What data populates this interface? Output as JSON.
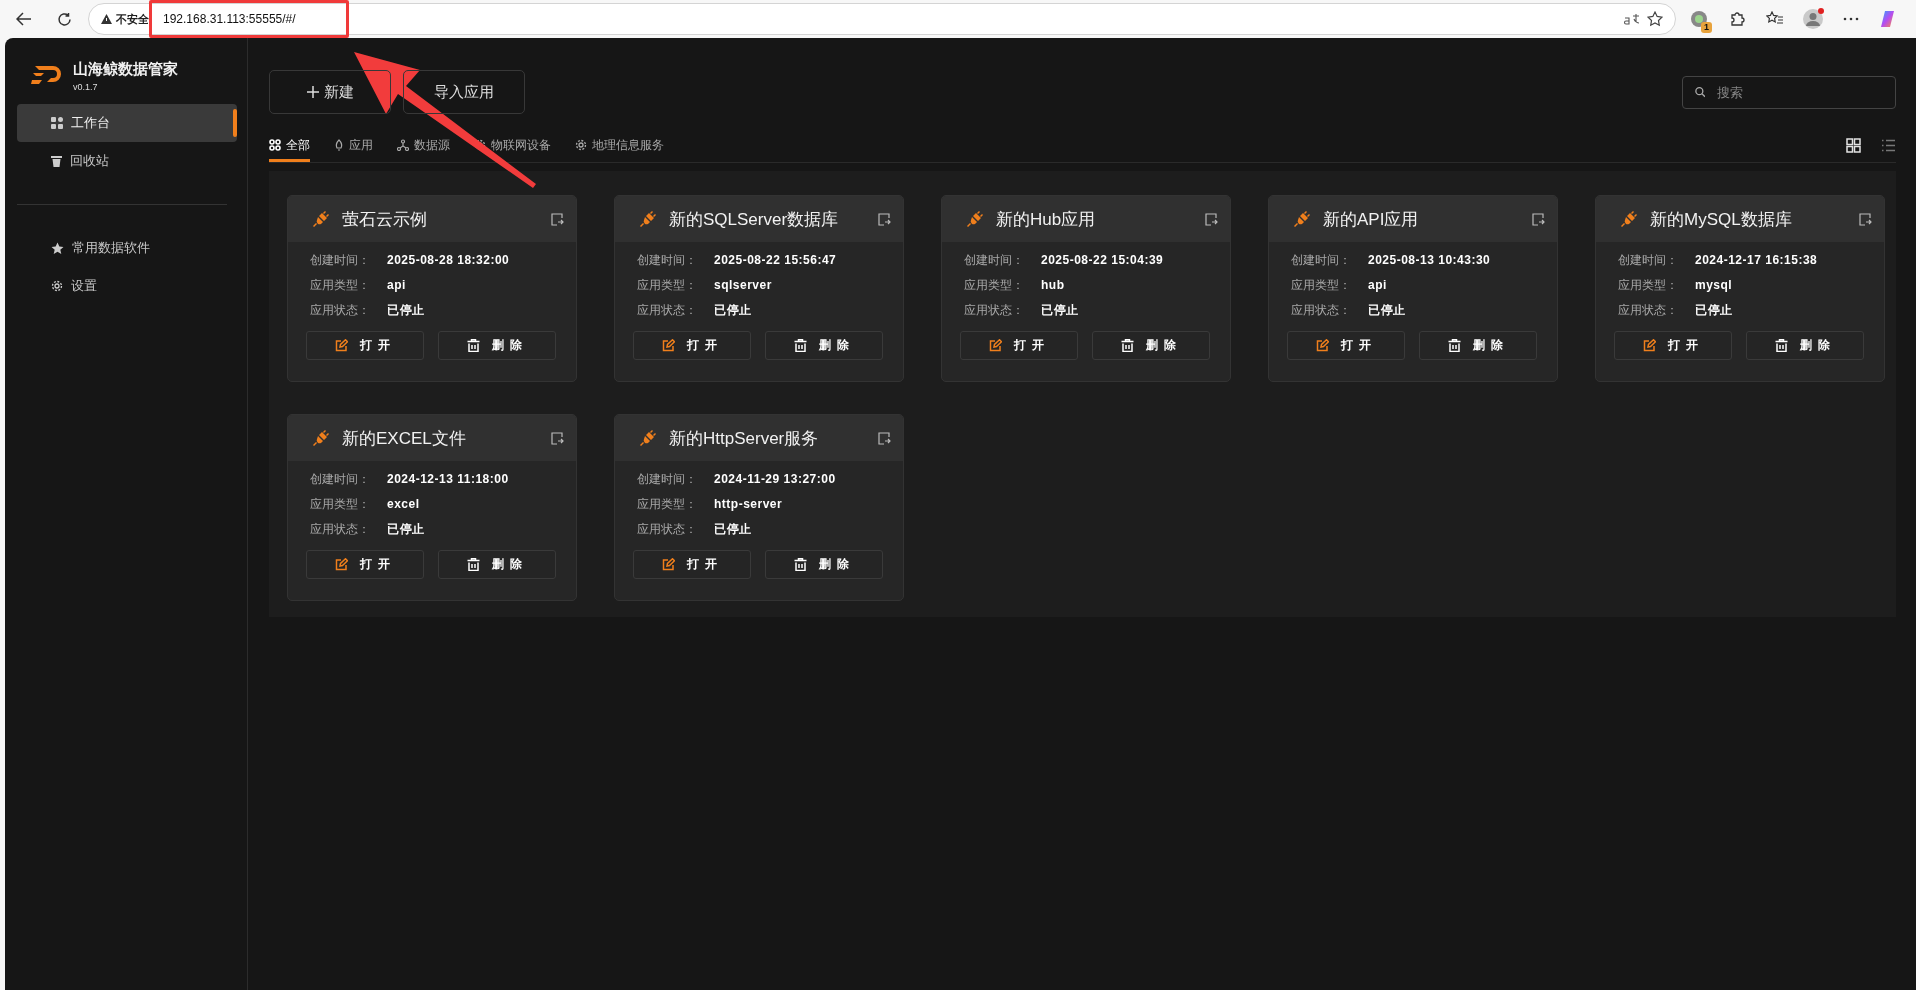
{
  "browser": {
    "security_label": "不安全",
    "url": "192.168.31.113:55555/#/",
    "extension_badge": "1"
  },
  "sidebar": {
    "app_name": "山海鲸数据管家",
    "version": "v0.1.7",
    "items": [
      {
        "kind": "workbench",
        "label": "工作台",
        "selected": true
      },
      {
        "kind": "trash",
        "label": "回收站",
        "selected": false
      }
    ],
    "secondary_items": [
      {
        "kind": "star",
        "label": "常用数据软件"
      },
      {
        "kind": "gear",
        "label": "设置"
      }
    ]
  },
  "toolbar": {
    "buttons": [
      {
        "kind": "plus",
        "label": "新建"
      },
      {
        "kind": "plain",
        "label": "导入应用"
      }
    ],
    "search": {
      "placeholder": "搜索"
    }
  },
  "tabs": [
    {
      "kind": "grid",
      "label": "全部",
      "selected": true
    },
    {
      "kind": "rocket",
      "label": "应用",
      "selected": false
    },
    {
      "kind": "nodes",
      "label": "数据源",
      "selected": false
    },
    {
      "kind": "gear",
      "label": "物联网设备",
      "selected": false
    },
    {
      "kind": "gear",
      "label": "地理信息服务",
      "selected": false
    }
  ],
  "view_toggles": [
    {
      "kind": "grid",
      "selected": true
    },
    {
      "kind": "list",
      "selected": false
    }
  ],
  "cards": [
    {
      "title": "萤石云示例",
      "fields": [
        {
          "label": "创建时间：",
          "value": "2025-08-28 18:32:00"
        },
        {
          "label": "应用类型：",
          "value": "api"
        },
        {
          "label": "应用状态：",
          "value": "已停止"
        }
      ],
      "actions": [
        {
          "kind": "open",
          "label": "打开"
        },
        {
          "kind": "delete",
          "label": "删除"
        }
      ]
    },
    {
      "title": "新的SQLServer数据库",
      "fields": [
        {
          "label": "创建时间：",
          "value": "2025-08-22 15:56:47"
        },
        {
          "label": "应用类型：",
          "value": "sqlserver"
        },
        {
          "label": "应用状态：",
          "value": "已停止"
        }
      ],
      "actions": [
        {
          "kind": "open",
          "label": "打开"
        },
        {
          "kind": "delete",
          "label": "删除"
        }
      ]
    },
    {
      "title": "新的Hub应用",
      "fields": [
        {
          "label": "创建时间：",
          "value": "2025-08-22 15:04:39"
        },
        {
          "label": "应用类型：",
          "value": "hub"
        },
        {
          "label": "应用状态：",
          "value": "已停止"
        }
      ],
      "actions": [
        {
          "kind": "open",
          "label": "打开"
        },
        {
          "kind": "delete",
          "label": "删除"
        }
      ]
    },
    {
      "title": "新的API应用",
      "fields": [
        {
          "label": "创建时间：",
          "value": "2025-08-13 10:43:30"
        },
        {
          "label": "应用类型：",
          "value": "api"
        },
        {
          "label": "应用状态：",
          "value": "已停止"
        }
      ],
      "actions": [
        {
          "kind": "open",
          "label": "打开"
        },
        {
          "kind": "delete",
          "label": "删除"
        }
      ]
    },
    {
      "title": "新的MySQL数据库",
      "fields": [
        {
          "label": "创建时间：",
          "value": "2024-12-17 16:15:38"
        },
        {
          "label": "应用类型：",
          "value": "mysql"
        },
        {
          "label": "应用状态：",
          "value": "已停止"
        }
      ],
      "actions": [
        {
          "kind": "open",
          "label": "打开"
        },
        {
          "kind": "delete",
          "label": "删除"
        }
      ]
    },
    {
      "title": "新的EXCEL文件",
      "fields": [
        {
          "label": "创建时间：",
          "value": "2024-12-13 11:18:00"
        },
        {
          "label": "应用类型：",
          "value": "excel"
        },
        {
          "label": "应用状态：",
          "value": "已停止"
        }
      ],
      "actions": [
        {
          "kind": "open",
          "label": "打开"
        },
        {
          "kind": "delete",
          "label": "删除"
        }
      ]
    },
    {
      "title": "新的HttpServer服务",
      "fields": [
        {
          "label": "创建时间：",
          "value": "2024-11-29 13:27:00"
        },
        {
          "label": "应用类型：",
          "value": "http-server"
        },
        {
          "label": "应用状态：",
          "value": "已停止"
        }
      ],
      "actions": [
        {
          "kind": "open",
          "label": "打开"
        },
        {
          "kind": "delete",
          "label": "删除"
        }
      ]
    }
  ]
}
